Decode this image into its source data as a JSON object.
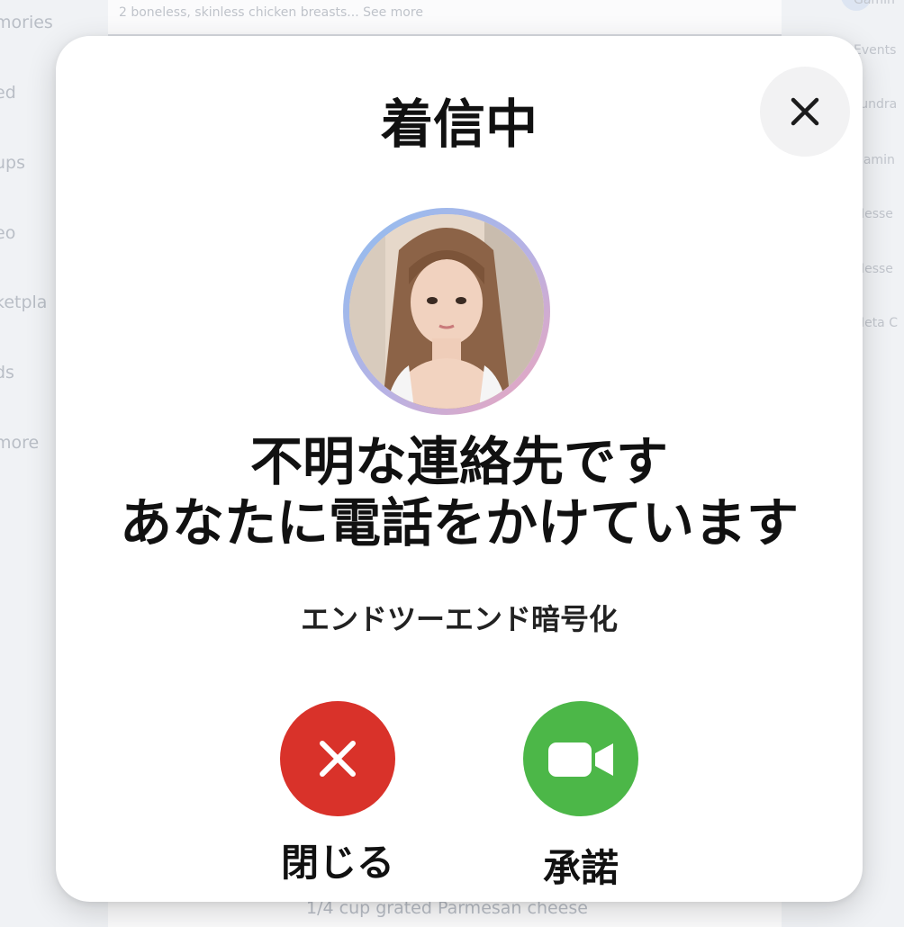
{
  "background": {
    "left_nav": [
      "mories",
      "ed",
      "ups",
      "eo",
      "ketpla",
      "ds",
      "more"
    ],
    "right_nav": [
      "Gamin",
      "Events",
      "Fundra",
      "Gamin",
      "Messe",
      "Messe",
      "Meta C"
    ],
    "post_snippet": "2 boneless, skinless chicken breasts... See more",
    "post_bottom_text": "1/4 cup grated Parmesan cheese"
  },
  "modal": {
    "title": "着信中",
    "close_icon": "close-icon",
    "caller_line_1": "不明な連絡先です",
    "caller_line_2": "あなたに電話をかけています",
    "encryption_text": "エンドツーエンド暗号化",
    "decline_label": "閉じる",
    "accept_label": "承諾",
    "decline_icon": "close-icon",
    "accept_icon": "video-camera-icon"
  },
  "colors": {
    "decline": "#d9322a",
    "accept": "#4cb748",
    "avatar_ring_start": "#8fbdf0",
    "avatar_ring_end": "#efa4ba"
  }
}
